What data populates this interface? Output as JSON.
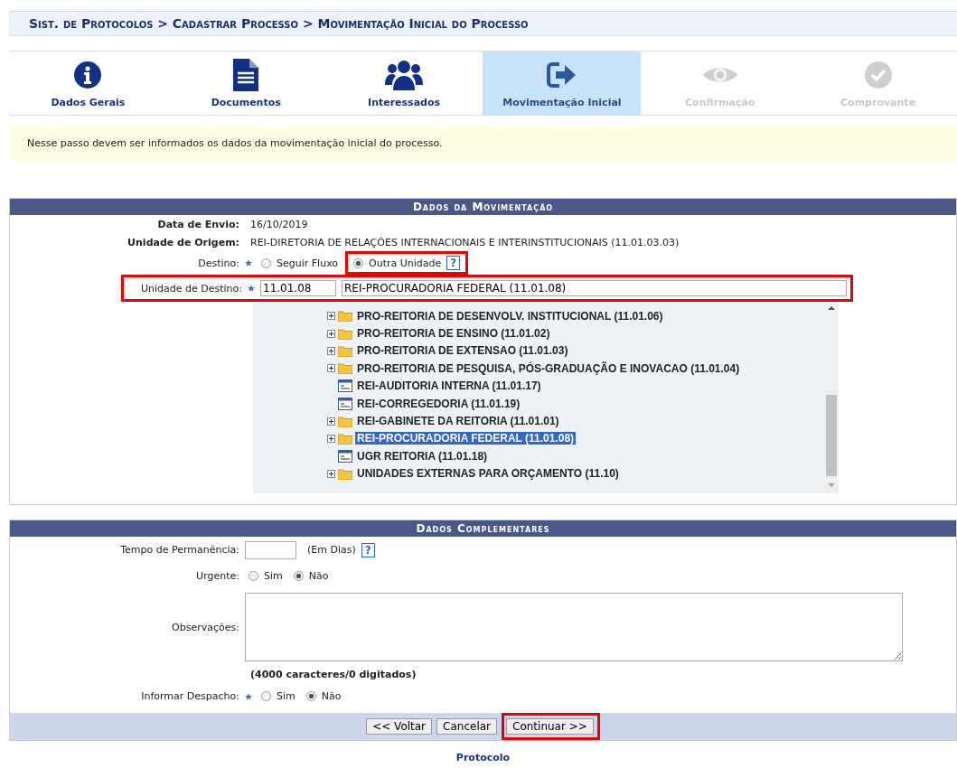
{
  "breadcrumb": "Sist. de Protocolos > Cadastrar Processo > Movimentação Inicial do Processo",
  "steps": [
    {
      "label": "Dados Gerais",
      "kind": "info",
      "selected": false,
      "disabled": false
    },
    {
      "label": "Documentos",
      "kind": "document",
      "selected": false,
      "disabled": false
    },
    {
      "label": "Interessados",
      "kind": "people",
      "selected": false,
      "disabled": false
    },
    {
      "label": "Movimentação Inicial",
      "kind": "exit",
      "selected": true,
      "disabled": false
    },
    {
      "label": "Confirmação",
      "kind": "eye",
      "selected": false,
      "disabled": true
    },
    {
      "label": "Comprovante",
      "kind": "check",
      "selected": false,
      "disabled": true
    }
  ],
  "info": "Nesse passo devem ser informados os dados da movimentação inicial do processo.",
  "movimentacao": {
    "title": "Dados da Movimentação",
    "data_envio": {
      "label": "Data de Envio:",
      "value": "16/10/2019"
    },
    "unidade_origem": {
      "label": "Unidade de Origem:",
      "value": "REI-DIRETORIA DE RELAÇÕES INTERNACIONAIS E INTERINSTITUCIONAIS (11.01.03.03)"
    },
    "destino": {
      "label": "Destino:",
      "required": true,
      "help": "?",
      "options": [
        {
          "label": "Seguir Fluxo",
          "selected": false,
          "highlighted": false
        },
        {
          "label": "Outra Unidade",
          "selected": true,
          "highlighted": true
        }
      ]
    },
    "unidade_destino": {
      "label": "Unidade de Destino:",
      "required": true,
      "highlighted": true,
      "code": "11.01.08",
      "name": "REI-PROCURADORIA FEDERAL (11.01.08)"
    },
    "tree": [
      {
        "label": "PRO-REITORIA DE DESENVOLV. INSTITUCIONAL (11.01.06)",
        "kind": "folder",
        "selected": false
      },
      {
        "label": "PRO-REITORIA DE ENSINO (11.01.02)",
        "kind": "folder",
        "selected": false
      },
      {
        "label": "PRO-REITORIA DE EXTENSAO (11.01.03)",
        "kind": "folder",
        "selected": false
      },
      {
        "label": "PRO-REITORIA DE PESQUISA, PÓS-GRADUAÇÃO E INOVACAO (11.01.04)",
        "kind": "folder",
        "selected": false
      },
      {
        "label": "REI-AUDITORIA INTERNA (11.01.17)",
        "kind": "unit",
        "selected": false
      },
      {
        "label": "REI-CORREGEDORIA (11.01.19)",
        "kind": "unit",
        "selected": false
      },
      {
        "label": "REI-GABINETE DA REITORIA (11.01.01)",
        "kind": "folder",
        "selected": false
      },
      {
        "label": "REI-PROCURADORIA FEDERAL (11.01.08)",
        "kind": "folder",
        "selected": true
      },
      {
        "label": "UGR REITORIA (11.01.18)",
        "kind": "unit",
        "selected": false
      },
      {
        "label": "UNIDADES EXTERNAS PARA ORÇAMENTO (11.10)",
        "kind": "folder",
        "selected": false
      }
    ]
  },
  "complementares": {
    "title": "Dados Complementares",
    "tempo": {
      "label": "Tempo de Permanência:",
      "suffix": "(Em Dias)",
      "help": "?"
    },
    "urgente": {
      "label": "Urgente:",
      "required": false,
      "options": [
        {
          "label": "Sim",
          "selected": false
        },
        {
          "label": "Não",
          "selected": true
        }
      ]
    },
    "observacoes": {
      "label": "Observações:",
      "counter": "(4000 caracteres/0 digitados)"
    },
    "despacho": {
      "label": "Informar Despacho:",
      "required": true,
      "options": [
        {
          "label": "Sim",
          "selected": false
        },
        {
          "label": "Não",
          "selected": true
        }
      ]
    }
  },
  "buttons": [
    {
      "label": "<< Voltar",
      "highlighted": false
    },
    {
      "label": "Cancelar",
      "highlighted": false
    },
    {
      "label": "Continuar >>",
      "highlighted": true
    }
  ],
  "footer": "Protocolo"
}
